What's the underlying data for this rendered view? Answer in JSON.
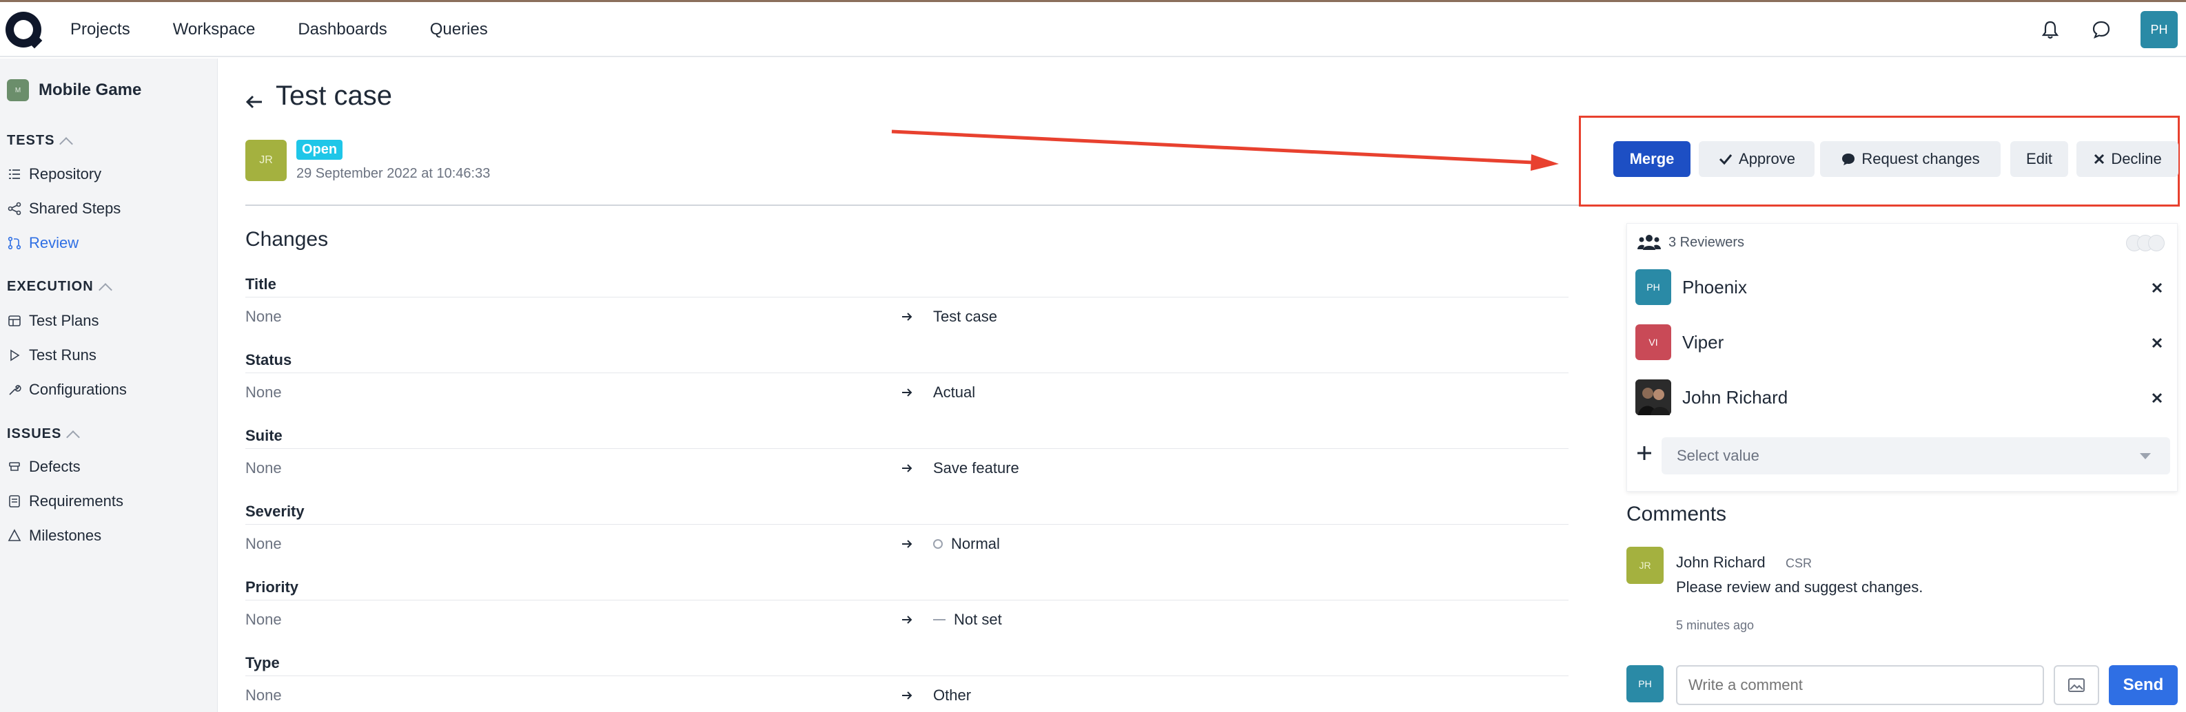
{
  "nav": {
    "items": [
      "Projects",
      "Workspace",
      "Dashboards",
      "Queries"
    ],
    "user_initials": "PH"
  },
  "sidebar": {
    "project_badge": "M",
    "project_name": "Mobile Game",
    "sections": [
      {
        "title": "TESTS",
        "items": [
          "Repository",
          "Shared Steps",
          "Review"
        ]
      },
      {
        "title": "EXECUTION",
        "items": [
          "Test Plans",
          "Test Runs",
          "Configurations"
        ]
      },
      {
        "title": "ISSUES",
        "items": [
          "Defects",
          "Requirements",
          "Milestones"
        ]
      }
    ],
    "active_item": "Review"
  },
  "page": {
    "title": "Test case",
    "author_initials": "JR",
    "status": "Open",
    "date": "29 September 2022 at 10:46:33"
  },
  "changes": {
    "heading": "Changes",
    "rows": [
      {
        "field": "Title",
        "old": "None",
        "new": "Test case"
      },
      {
        "field": "Status",
        "old": "None",
        "new": "Actual"
      },
      {
        "field": "Suite",
        "old": "None",
        "new": "Save feature"
      },
      {
        "field": "Severity",
        "old": "None",
        "new": "Normal"
      },
      {
        "field": "Priority",
        "old": "None",
        "new": "Not set"
      },
      {
        "field": "Type",
        "old": "None",
        "new": "Other"
      }
    ]
  },
  "actions": {
    "merge": "Merge",
    "approve": "Approve",
    "request_changes": "Request changes",
    "edit": "Edit",
    "decline": "Decline"
  },
  "reviewers": {
    "heading": "3 Reviewers",
    "list": [
      {
        "initials": "PH",
        "name": "Phoenix",
        "color": "#2a8aa6"
      },
      {
        "initials": "VI",
        "name": "Viper",
        "color": "#c94a57"
      },
      {
        "initials": "",
        "name": "John Richard",
        "color": "#3a3a3a"
      }
    ],
    "select_placeholder": "Select value"
  },
  "comments": {
    "heading": "Comments",
    "items": [
      {
        "initials": "JR",
        "author": "John Richard",
        "role": "CSR",
        "text": "Please review and suggest changes.",
        "time": "5 minutes ago"
      }
    ],
    "composer": {
      "initials": "PH",
      "placeholder": "Write a comment",
      "send": "Send"
    }
  },
  "colors": {
    "primary": "#2f6fe4",
    "merge": "#1d4fc4",
    "open_badge": "#1fc6e8",
    "annotation_red": "#e8412f"
  }
}
